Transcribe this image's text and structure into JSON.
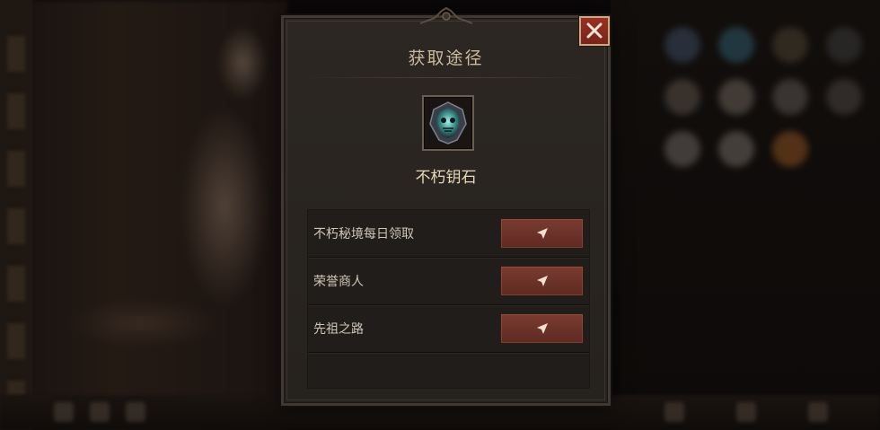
{
  "dialog": {
    "title": "获取途径",
    "item_name": "不朽钥石",
    "item_icon": "immortal-keystone-icon",
    "close_icon": "close-icon",
    "sources": [
      {
        "label": "不朽秘境每日领取",
        "button_icon": "navigate-arrow-icon"
      },
      {
        "label": "荣誉商人",
        "button_icon": "navigate-arrow-icon"
      },
      {
        "label": "先祖之路",
        "button_icon": "navigate-arrow-icon"
      }
    ]
  },
  "colors": {
    "accent_button": "#6b322a",
    "close_button": "#8a2a1c",
    "title_text": "#cbb99c",
    "item_name_text": "#e6d8b8"
  }
}
